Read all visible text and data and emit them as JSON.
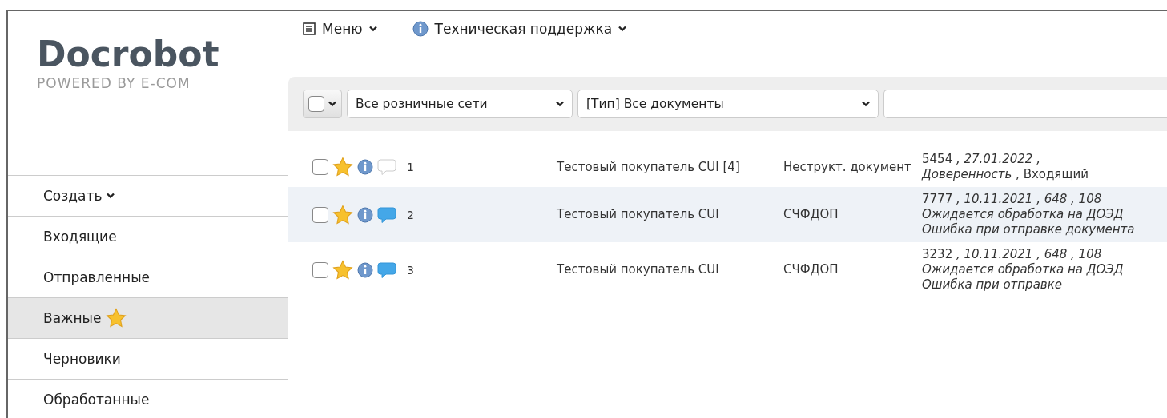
{
  "logo": {
    "name": "Docrobot",
    "tagline": "POWERED BY E-COM"
  },
  "top_menu": [
    {
      "label": "Меню",
      "kind": "list"
    },
    {
      "label": "Техническая поддержка",
      "kind": "info"
    }
  ],
  "sidebar": {
    "items": [
      {
        "label": "Создать",
        "kind": "dropdown",
        "selected": false
      },
      {
        "label": "Входящие",
        "kind": "plain",
        "selected": false
      },
      {
        "label": "Отправленные",
        "kind": "plain",
        "selected": false
      },
      {
        "label": "Важные",
        "kind": "starred",
        "selected": true
      },
      {
        "label": "Черновики",
        "kind": "plain",
        "selected": false
      },
      {
        "label": "Обработанные",
        "kind": "plain",
        "selected": false
      }
    ]
  },
  "toolbar": {
    "select_all": {
      "checked": false
    },
    "filters": [
      {
        "value": "Все розничные сети"
      },
      {
        "value": "[Тип] Все документы"
      }
    ]
  },
  "rows": [
    {
      "checked": false,
      "starred": true,
      "has_comments": false,
      "number": "1",
      "buyer": "Тестовый покупатель CUI [4]",
      "doc_type": "Неструкт. документ",
      "details": [
        "5454 *, 27.01.2022 ,*",
        "*Доверенность* , Входящий"
      ]
    },
    {
      "checked": false,
      "starred": true,
      "has_comments": true,
      "number": "2",
      "buyer": "Тестовый покупатель CUI",
      "doc_type": "СЧФДОП",
      "details": [
        "7777 *, 10.11.2021 , 648 , 108*",
        "*Ожидается обработка на ДОЭД*",
        "*Ошибка при отправке документа*"
      ]
    },
    {
      "checked": false,
      "starred": true,
      "has_comments": true,
      "number": "3",
      "buyer": "Тестовый покупатель CUI",
      "doc_type": "СЧФДОП",
      "details": [
        "3232 *, 10.11.2021 , 648 , 108*",
        "*Ожидается обработка на ДОЭД*",
        "*Ошибка при отправке*"
      ]
    }
  ]
}
